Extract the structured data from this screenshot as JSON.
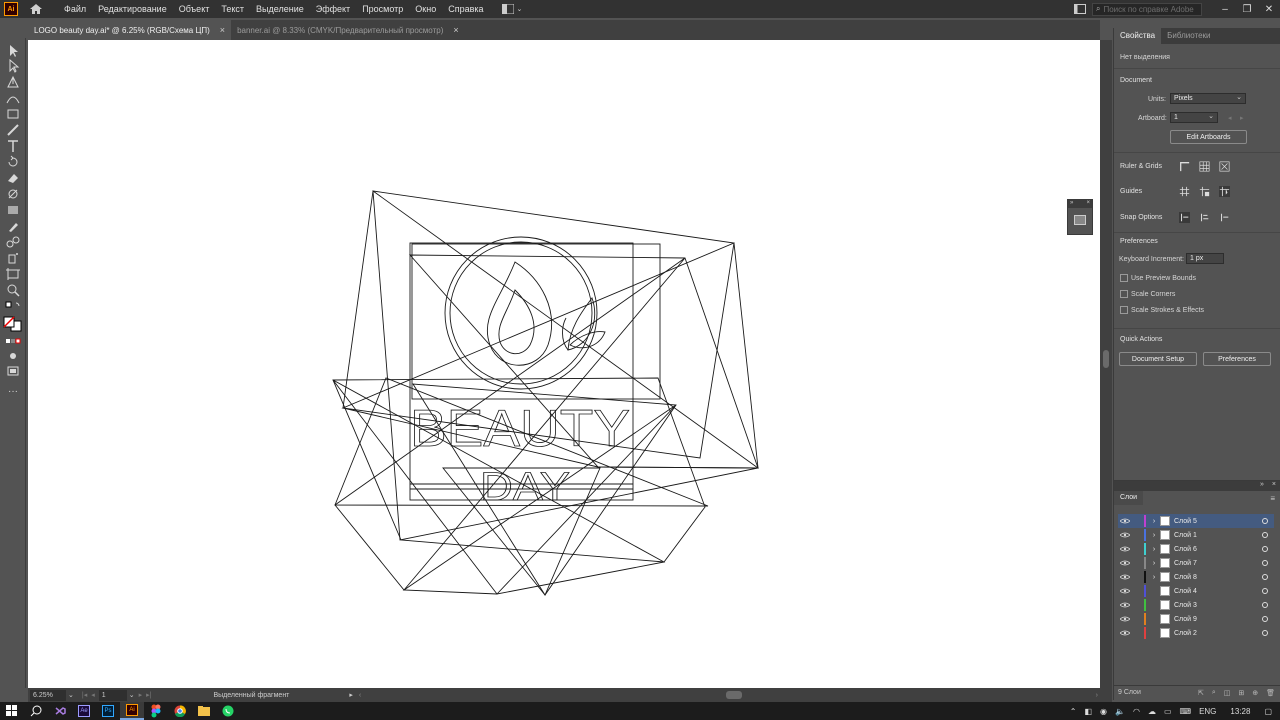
{
  "app": {
    "logo": "Ai"
  },
  "menu": [
    "Файл",
    "Редактирование",
    "Объект",
    "Текст",
    "Выделение",
    "Эффект",
    "Просмотр",
    "Окно",
    "Справка"
  ],
  "search": {
    "placeholder": "Поиск по справке Adobe"
  },
  "tabs": [
    {
      "label": "LOGO beauty day.ai* @ 6.25% (RGB/Схема ЦП)",
      "active": true
    },
    {
      "label": "banner.ai @ 8.33% (CMYK/Предварительный просмотр)",
      "active": false
    }
  ],
  "canvas": {
    "text_beauty": "BEAUTY",
    "text_day": "DAY"
  },
  "status": {
    "zoom": "6.25%",
    "artboard": "1",
    "text": "Выделенный фрагмент"
  },
  "properties": {
    "tab_properties": "Свойства",
    "tab_libraries": "Библиотеки",
    "no_selection": "Нет выделения",
    "document": "Document",
    "units_label": "Units:",
    "units_value": "Pixels",
    "artboard_label": "Artboard:",
    "artboard_value": "1",
    "edit_artboards": "Edit Artboards",
    "ruler_grids": "Ruler & Grids",
    "guides": "Guides",
    "snap_options": "Snap Options",
    "preferences_title": "Preferences",
    "keyboard_increment_label": "Keyboard Increment:",
    "keyboard_increment_value": "1 px",
    "use_preview_bounds": "Use Preview Bounds",
    "scale_corners": "Scale Corners",
    "scale_strokes": "Scale Strokes & Effects",
    "quick_actions": "Quick Actions",
    "document_setup": "Document Setup",
    "preferences_btn": "Preferences"
  },
  "layers": {
    "tab": "Слои",
    "footer_count": "9 Слои",
    "items": [
      {
        "name": "Слой 5",
        "color": "#c040d0",
        "expand": true,
        "selected": true
      },
      {
        "name": "Слой 1",
        "color": "#4a72e0",
        "expand": true,
        "selected": false
      },
      {
        "name": "Слой 6",
        "color": "#3fd0d0",
        "expand": true,
        "selected": false
      },
      {
        "name": "Слой 7",
        "color": "#888888",
        "expand": true,
        "selected": false
      },
      {
        "name": "Слой 8",
        "color": "#111111",
        "expand": true,
        "selected": false
      },
      {
        "name": "Слой 4",
        "color": "#5050d8",
        "expand": false,
        "selected": false
      },
      {
        "name": "Слой 3",
        "color": "#40c040",
        "expand": false,
        "selected": false
      },
      {
        "name": "Слой 9",
        "color": "#e08020",
        "expand": false,
        "selected": false
      },
      {
        "name": "Слой 2",
        "color": "#e04040",
        "expand": false,
        "selected": false
      }
    ]
  },
  "taskbar": {
    "lang": "ENG",
    "time": "13:28"
  }
}
